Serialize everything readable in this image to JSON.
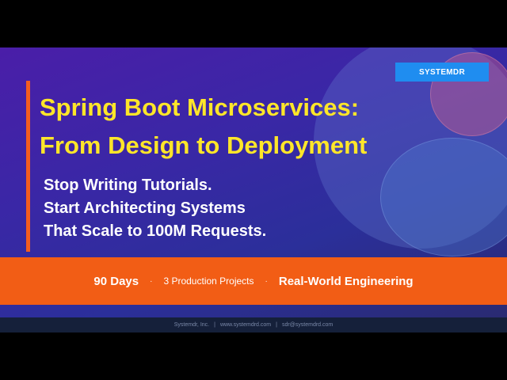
{
  "brand": {
    "label": "SYSTEMDR"
  },
  "title": {
    "line1": "Spring Boot Microservices:",
    "line2": "From Design to Deployment"
  },
  "subtitle": {
    "line1": "Stop Writing Tutorials.",
    "line2": "Start Architecting Systems",
    "line3": "That Scale to 100M Requests."
  },
  "highlights": {
    "item1": "90 Days",
    "sep": "·",
    "item2": "3 Production Projects",
    "item3": "Real-World Engineering"
  },
  "footer": {
    "company": "Systemdr, Inc.",
    "divider": "|",
    "website": "www.systemdrd.com",
    "email": "sdr@systemdrd.com"
  },
  "colors": {
    "title": "#ffe629",
    "accent_bar": "#f45d1f",
    "band": "#f25d15",
    "badge": "#1f8df0"
  }
}
